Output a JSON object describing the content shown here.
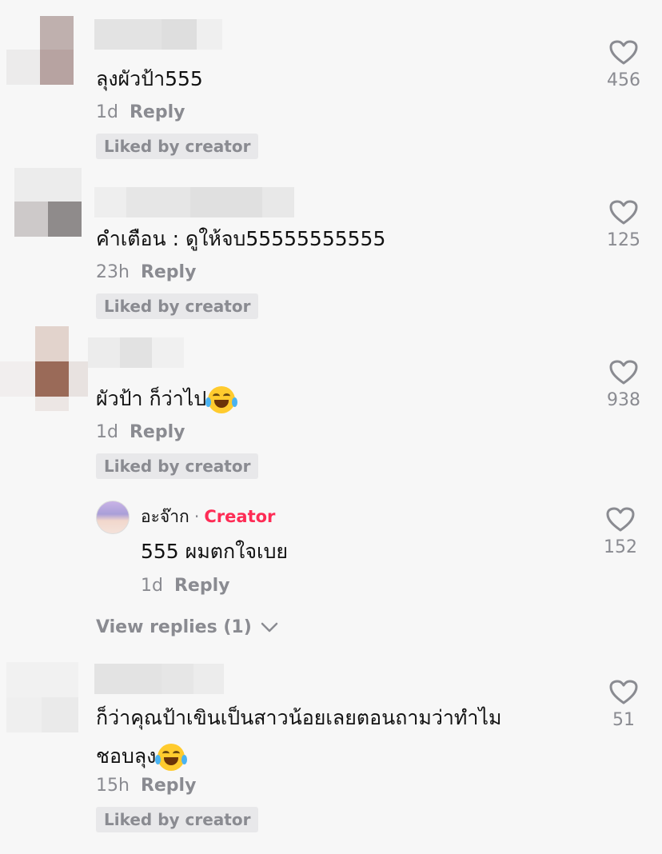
{
  "comments": [
    {
      "text": "ลุงผัวป้า555",
      "time": "1d",
      "reply": "Reply",
      "badge": "Liked by creator",
      "likes": "456"
    },
    {
      "text": "คำเตือน : ดูให้จบ55555555555",
      "time": "23h",
      "reply": "Reply",
      "badge": "Liked by creator",
      "likes": "125"
    },
    {
      "text": "ผัวป้า ก็ว่าไป",
      "time": "1d",
      "reply": "Reply",
      "badge": "Liked by creator",
      "likes": "938"
    },
    {
      "text_line1": "ก็ว่าคุณป้าเขินเป็นสาวน้อยเลยตอนถามว่าทำไม",
      "text_line2": "ชอบลุง",
      "time": "15h",
      "reply": "Reply",
      "badge": "Liked by creator",
      "likes": "51"
    }
  ],
  "creator_reply": {
    "name": "อะจ๊าก",
    "dot": "·",
    "tag": "Creator",
    "text": "555 ผมตกใจเบย",
    "time": "1d",
    "reply": "Reply",
    "likes": "152"
  },
  "view_replies": "View replies (1)",
  "icons": {
    "like": "heart-outline-icon",
    "emoji": "face-with-tears-of-joy-icon",
    "chevron": "chevron-down-icon"
  },
  "colors": {
    "creator_tag": "#fe2c55",
    "meta": "#8a8b91",
    "badge_bg": "#e8e8ea"
  }
}
